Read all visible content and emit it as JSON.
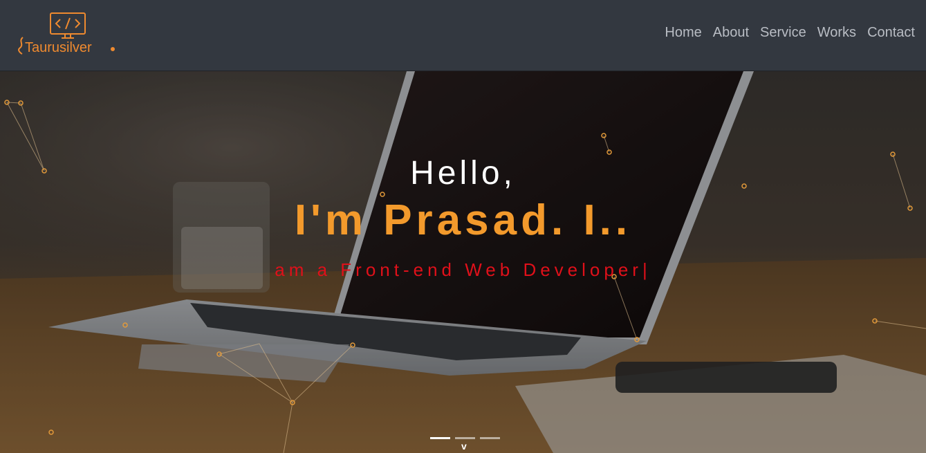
{
  "brand": {
    "name": "Taurusilver"
  },
  "nav": {
    "items": [
      {
        "label": "Home"
      },
      {
        "label": "About"
      },
      {
        "label": "Service"
      },
      {
        "label": "Works"
      },
      {
        "label": "Contact"
      }
    ]
  },
  "hero": {
    "greeting": "Hello,",
    "headline": "I'm Prasad. I..",
    "subline": "am a Front-end Web Developer",
    "caret": "|",
    "scroll_label": "v",
    "slides": 3,
    "active_slide": 1
  },
  "colors": {
    "accent": "#f39a2c",
    "subline": "#e0101a",
    "navbar": "#333840",
    "nav_text": "#b9bdc4"
  }
}
